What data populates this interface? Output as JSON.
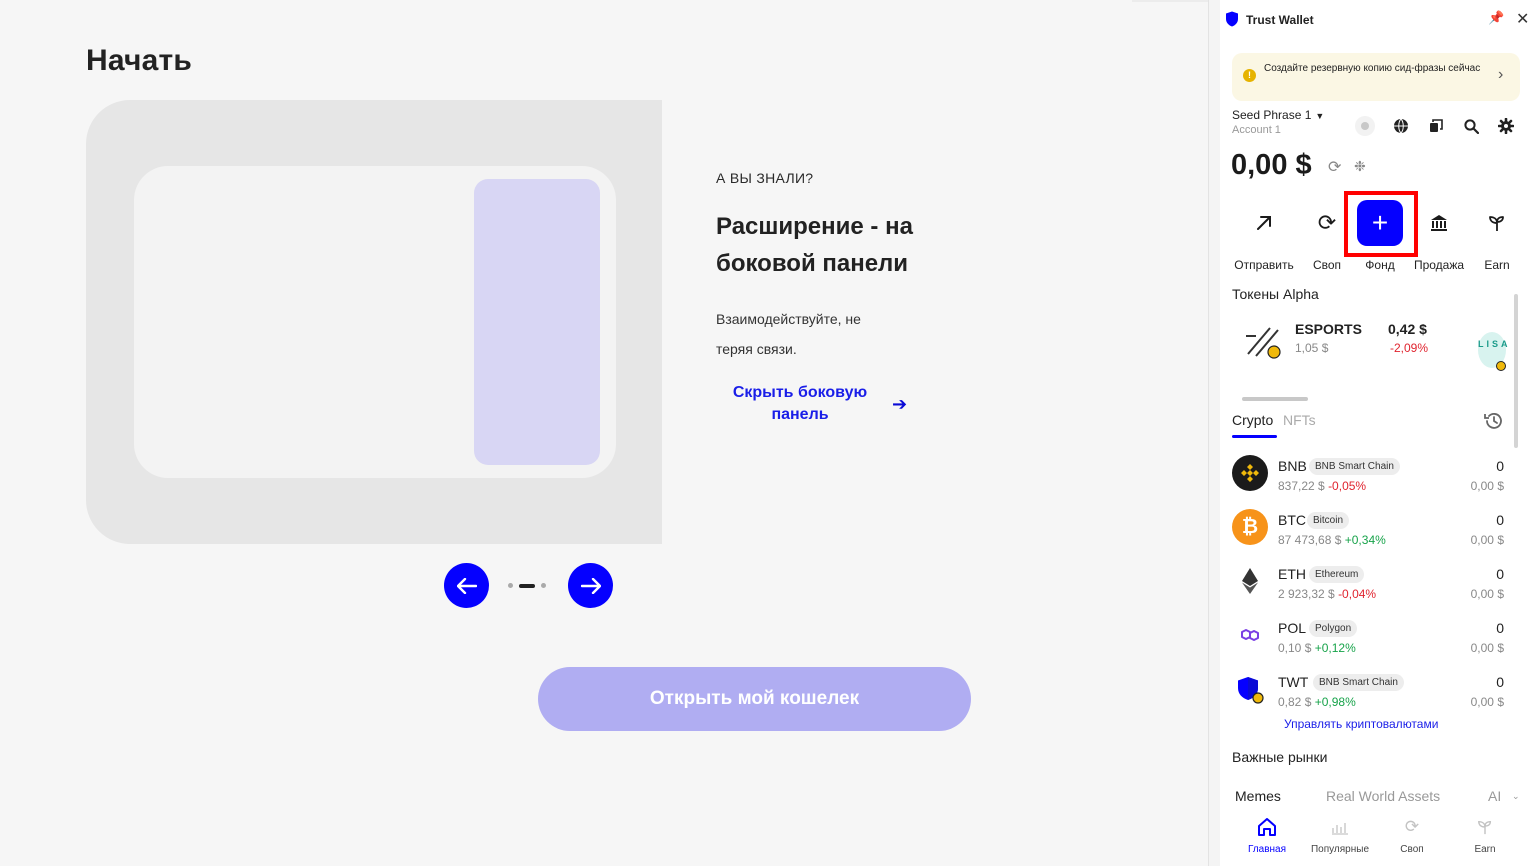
{
  "onboarding": {
    "title": "Начать",
    "kicker": "А ВЫ ЗНАЛИ?",
    "heading": "Расширение - на боковой панели",
    "description": "Взаимодействуйте, не теряя связи.",
    "hide_link": "Скрыть боковую панель",
    "hide_link_icon": "arrow-right-icon",
    "open_wallet": "Открыть мой кошелек",
    "carousel": {
      "current": 2,
      "total": 3,
      "accent": "#0500ff"
    }
  },
  "panel": {
    "app_title": "Trust Wallet",
    "banner": "Создайте резервную копию сид-фразы сейчас",
    "banner_icon": "warning-icon",
    "account": {
      "phrase": "Seed Phrase 1",
      "name": "Account 1"
    },
    "balance": "0,00 $",
    "toolbar_icons": [
      "status-dot-icon",
      "globe-icon",
      "copy-icon",
      "search-icon",
      "gear-icon"
    ],
    "actions": [
      {
        "label": "Отправить",
        "icon": "send-arrow-icon"
      },
      {
        "label": "Своп",
        "icon": "swap-icon"
      },
      {
        "label": "Фонд",
        "icon": "plus-icon"
      },
      {
        "label": "Продажа",
        "icon": "bank-icon"
      },
      {
        "label": "Earn",
        "icon": "sprout-icon"
      }
    ],
    "alpha": {
      "title": "Токены Alpha",
      "tokens": [
        {
          "symbol": "ESPORTS",
          "price": "1,05 $",
          "value": "0,42 $",
          "change": "-2,09%"
        }
      ],
      "next_badge": "LISA"
    },
    "tabs": {
      "crypto": "Crypto",
      "nfts": "NFTs"
    },
    "tokens": [
      {
        "symbol": "BNB",
        "chain": "BNB Smart Chain",
        "price": "837,22 $",
        "change": "-0,05%",
        "amount": "0",
        "fiat": "0,00 $",
        "color": "#1b1b1b"
      },
      {
        "symbol": "BTC",
        "chain": "Bitcoin",
        "price": "87 473,68 $",
        "change": "+0,34%",
        "amount": "0",
        "fiat": "0,00 $",
        "color": "#f7931a"
      },
      {
        "symbol": "ETH",
        "chain": "Ethereum",
        "price": "2 923,32 $",
        "change": "-0,04%",
        "amount": "0",
        "fiat": "0,00 $",
        "color": "#ffffff"
      },
      {
        "symbol": "POL",
        "chain": "Polygon",
        "price": "0,10 $",
        "change": "+0,12%",
        "amount": "0",
        "fiat": "0,00 $",
        "color": "#ffffff"
      },
      {
        "symbol": "TWT",
        "chain": "BNB Smart Chain",
        "price": "0,82 $",
        "change": "+0,98%",
        "amount": "0",
        "fiat": "0,00 $",
        "color": "#ffffff"
      }
    ],
    "manage": "Управлять криптовалютами",
    "markets": {
      "title": "Важные рынки",
      "tabs": [
        "Memes",
        "Real World Assets",
        "AI"
      ]
    },
    "bottom_nav": [
      {
        "label": "Главная",
        "icon": "home-icon"
      },
      {
        "label": "Популярные",
        "icon": "chart-icon"
      },
      {
        "label": "Своп",
        "icon": "swap-icon"
      },
      {
        "label": "Earn",
        "icon": "sprout-icon"
      }
    ]
  }
}
